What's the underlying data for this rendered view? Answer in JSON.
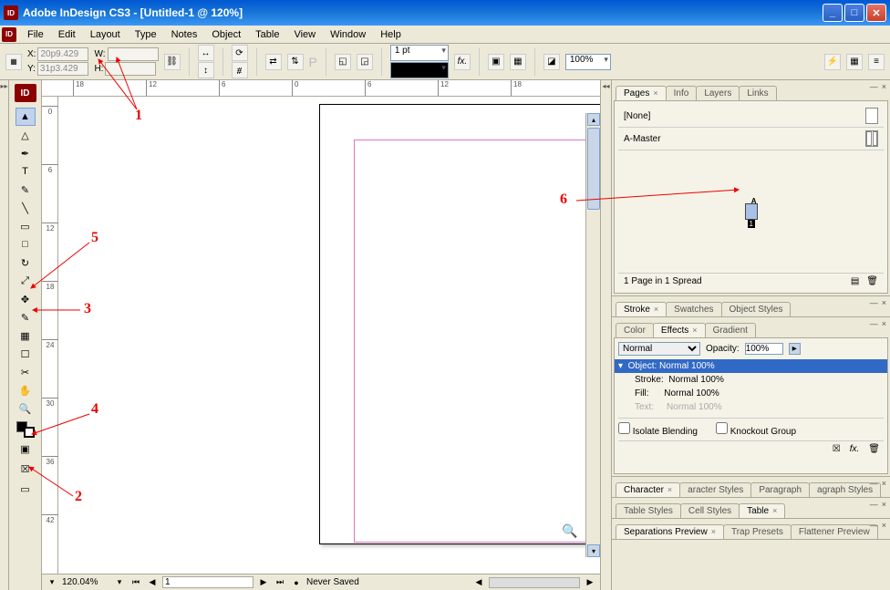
{
  "titlebar": {
    "app_icon": "ID",
    "title": "Adobe InDesign CS3 - [Untitled-1 @ 120%]"
  },
  "menubar": [
    "File",
    "Edit",
    "Layout",
    "Type",
    "Notes",
    "Object",
    "Table",
    "View",
    "Window",
    "Help"
  ],
  "control": {
    "x_label": "X:",
    "y_label": "Y:",
    "w_label": "W:",
    "h_label": "H:",
    "x": "20p9.429",
    "y": "31p3.429",
    "w": "",
    "h": "",
    "stroke_weight": "1 pt",
    "zoom": "100%",
    "opacity_field": "100%"
  },
  "tools": [
    {
      "name": "selection-tool",
      "glyph": "▲"
    },
    {
      "name": "direct-selection-tool",
      "glyph": "△"
    },
    {
      "name": "pen-tool",
      "glyph": "✒"
    },
    {
      "name": "type-tool",
      "glyph": "T"
    },
    {
      "name": "pencil-tool",
      "glyph": "✎"
    },
    {
      "name": "line-tool",
      "glyph": "╲"
    },
    {
      "name": "rectangle-frame-tool",
      "glyph": "▭"
    },
    {
      "name": "rectangle-tool",
      "glyph": "□"
    },
    {
      "name": "rotate-tool",
      "glyph": "↻"
    },
    {
      "name": "scale-tool",
      "glyph": "⤢"
    },
    {
      "name": "free-transform-tool",
      "glyph": "✥"
    },
    {
      "name": "eyedropper-tool",
      "glyph": "✎"
    },
    {
      "name": "gradient-tool",
      "glyph": "▦"
    },
    {
      "name": "button-tool",
      "glyph": "☐"
    },
    {
      "name": "scissors-tool",
      "glyph": "✂"
    },
    {
      "name": "hand-tool",
      "glyph": "✋"
    },
    {
      "name": "zoom-tool",
      "glyph": "🔍"
    }
  ],
  "ruler_ticks_h": [
    "18",
    "12",
    "6",
    "0",
    "6",
    "12",
    "18"
  ],
  "ruler_ticks_v": [
    "0",
    "6",
    "12",
    "18",
    "24",
    "30",
    "36",
    "42"
  ],
  "statusbar": {
    "zoom": "120.04%",
    "page": "1",
    "save_status": "Never Saved"
  },
  "panels": {
    "pages": {
      "tabs": [
        "Pages",
        "Info",
        "Layers",
        "Links"
      ],
      "none": "[None]",
      "master": "A-Master",
      "thumb_a": "A",
      "thumb_n": "1",
      "spread": "1 Page in 1 Spread"
    },
    "stroke": {
      "tabs": [
        "Stroke",
        "Swatches",
        "Object Styles"
      ]
    },
    "color": {
      "tabs": [
        "Color",
        "Effects",
        "Gradient"
      ],
      "mode": "Normal",
      "opacity_lbl": "Opacity:",
      "opacity": "100%",
      "obj": "Object: Normal 100%",
      "stroke_lbl": "Stroke:",
      "stroke_val": "Normal 100%",
      "fill_lbl": "Fill:",
      "fill_val": "Normal 100%",
      "text_lbl": "Text:",
      "text_val": "Normal 100%",
      "isolate": "Isolate Blending",
      "knockout": "Knockout Group"
    },
    "character": {
      "tabs": [
        "Character",
        "aracter Styles",
        "Paragraph",
        "agraph Styles"
      ]
    },
    "table": {
      "tabs": [
        "Table Styles",
        "Cell Styles",
        "Table"
      ]
    },
    "sep": {
      "tabs": [
        "Separations Preview",
        "Trap Presets",
        "Flattener Preview"
      ]
    }
  },
  "annotations": {
    "n1": "1",
    "n2": "2",
    "n3": "3",
    "n4": "4",
    "n5": "5",
    "n6": "6"
  }
}
